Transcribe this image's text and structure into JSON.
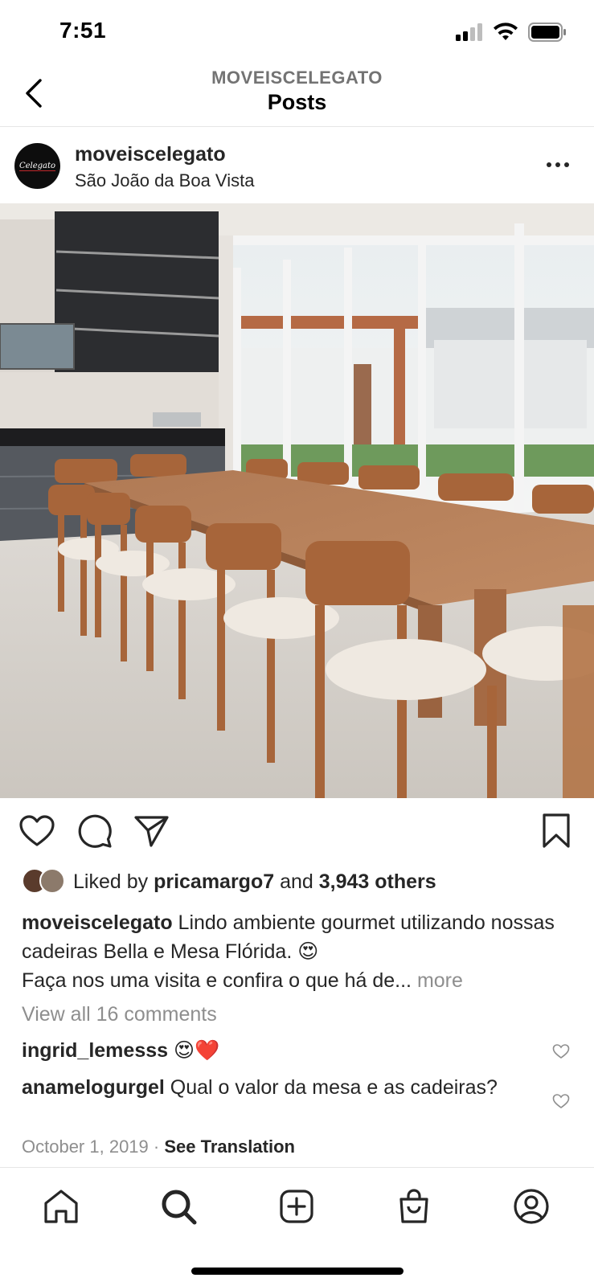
{
  "status_bar": {
    "time": "7:51"
  },
  "header": {
    "account_label": "MOVEISCELEGATO",
    "title": "Posts"
  },
  "post": {
    "avatar_text": "Celegato",
    "username": "moveiscelegato",
    "location": "São João da Boa Vista",
    "likes": {
      "prefix": "Liked by ",
      "liker": "pricamargo7",
      "middle": " and ",
      "count": "3,943 others"
    },
    "caption": {
      "username": "moveiscelegato",
      "line1": " Lindo ambiente gourmet utilizando nossas cadeiras Bella e Mesa Flórida. 😍",
      "line2": "Faça nos uma visita e confira o que há de...",
      "more": " more"
    },
    "view_comments": "View all 16 comments",
    "comments": [
      {
        "username": "ingrid_lemesss",
        "text": " 😍❤️"
      },
      {
        "username": "anamelogurgel",
        "text": " Qual o valor da mesa e as cadeiras?"
      }
    ],
    "date": "October 1, 2019",
    "separator": " · ",
    "see_translation": "See Translation"
  },
  "colors": {
    "text": "#262626",
    "muted": "#8e8e8e",
    "divider": "#e6e6e6"
  },
  "icons": [
    "back-chevron-icon",
    "more-dots-icon",
    "heart-icon",
    "comment-icon",
    "share-icon",
    "bookmark-icon",
    "home-icon",
    "search-icon",
    "create-icon",
    "shop-icon",
    "profile-icon"
  ]
}
